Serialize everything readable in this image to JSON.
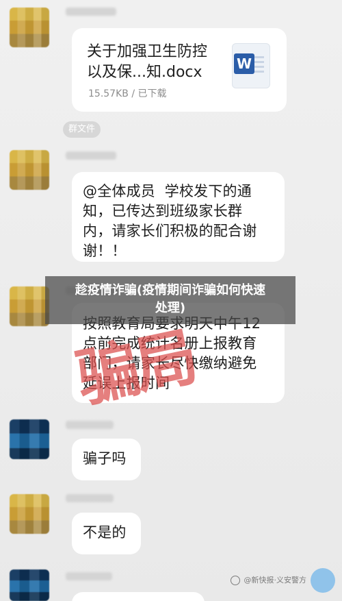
{
  "chat": {
    "file_message": {
      "filename": "关于加强卫生防控\n以及保...知.docx",
      "meta": "15.57KB / 已下载",
      "icon": "word-doc-icon"
    },
    "system_tag": "群文件",
    "messages": [
      {
        "text": "@全体成员  学校发下的通\n知，已传达到班级家长群\n内，请家长们积极的配合谢\n谢！！"
      },
      {
        "text": "按照教育局要求明天中午12\n点前完成统计名册上报教育\n部门，请家长尽快缴纳避免\n延误上报时间"
      },
      {
        "text": "骗子吗"
      },
      {
        "text": "不是的"
      }
    ],
    "stamp_text": "骗局"
  },
  "overlay": {
    "title_line_1": "趁疫情诈骗(疫情期间诈骗如何快速",
    "title_line_2": "处理)"
  },
  "watermark": {
    "text": "@新快报·义安警方"
  },
  "colors": {
    "bubble_bg": "#ffffff",
    "page_bg": "#ececec",
    "stamp_red": "#db4d4c",
    "overlay_bg": "#464646",
    "word_blue": "#2b5da8"
  }
}
